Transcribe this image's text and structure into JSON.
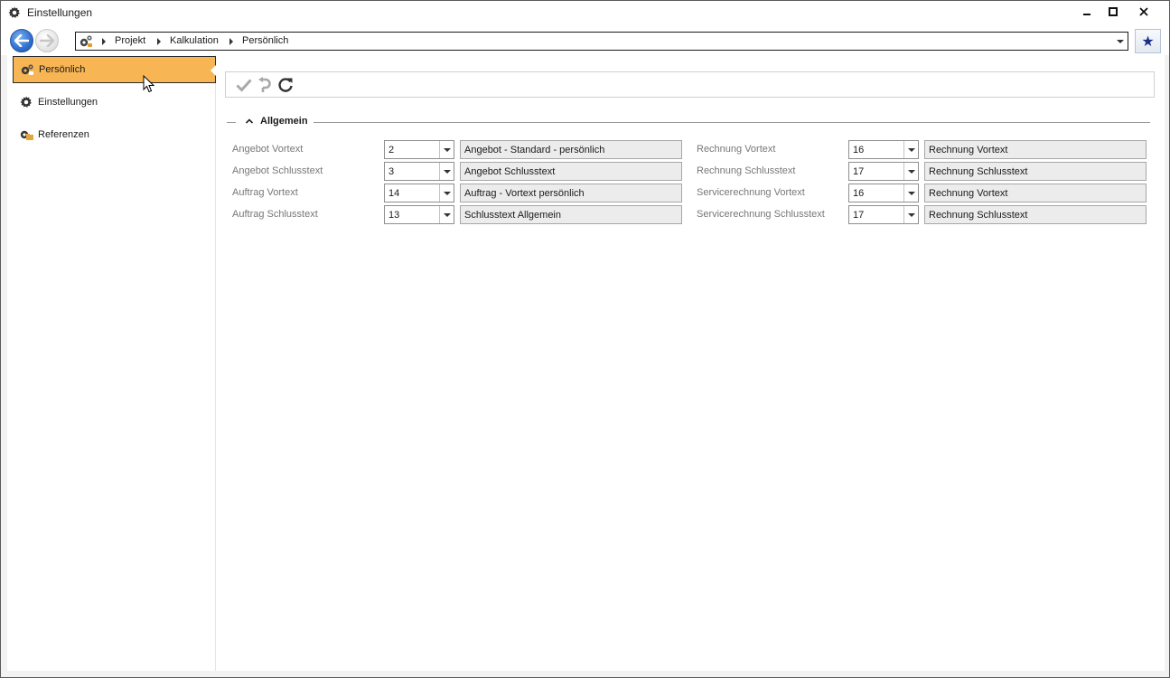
{
  "window": {
    "title": "Einstellungen",
    "icon": "gear-icon"
  },
  "breadcrumb": {
    "items": [
      "Projekt",
      "Kalkulation",
      "Persönlich"
    ]
  },
  "sidebar": {
    "items": [
      {
        "label": "Persönlich",
        "icon": "user-gear-icon",
        "active": true
      },
      {
        "label": "Einstellungen",
        "icon": "gear-icon",
        "active": false
      },
      {
        "label": "Referenzen",
        "icon": "folder-gear-icon",
        "active": false
      }
    ]
  },
  "toolbar": {
    "buttons": [
      "save-check-icon",
      "undo-icon",
      "refresh-icon"
    ]
  },
  "group": {
    "title": "Allgemein"
  },
  "fields_left": [
    {
      "label": "Angebot Vortext",
      "value": "2",
      "description": "Angebot - Standard - persönlich"
    },
    {
      "label": "Angebot Schlusstext",
      "value": "3",
      "description": "Angebot Schlusstext"
    },
    {
      "label": "Auftrag Vortext",
      "value": "14",
      "description": "Auftrag - Vortext persönlich"
    },
    {
      "label": "Auftrag Schlusstext",
      "value": "13",
      "description": "Schlusstext Allgemein"
    }
  ],
  "fields_right": [
    {
      "label": "Rechnung Vortext",
      "value": "16",
      "description": "Rechnung Vortext"
    },
    {
      "label": "Rechnung Schlusstext",
      "value": "17",
      "description": "Rechnung Schlusstext"
    },
    {
      "label": "Servicerechnung Vortext",
      "value": "16",
      "description": "Rechnung Vortext"
    },
    {
      "label": "Servicerechnung Schlusstext",
      "value": "17",
      "description": "Rechnung Schlusstext"
    }
  ],
  "colors": {
    "active_item": "#f8b554",
    "favorite_star": "#1b2f8a",
    "back_button": "#2e6fd1"
  }
}
